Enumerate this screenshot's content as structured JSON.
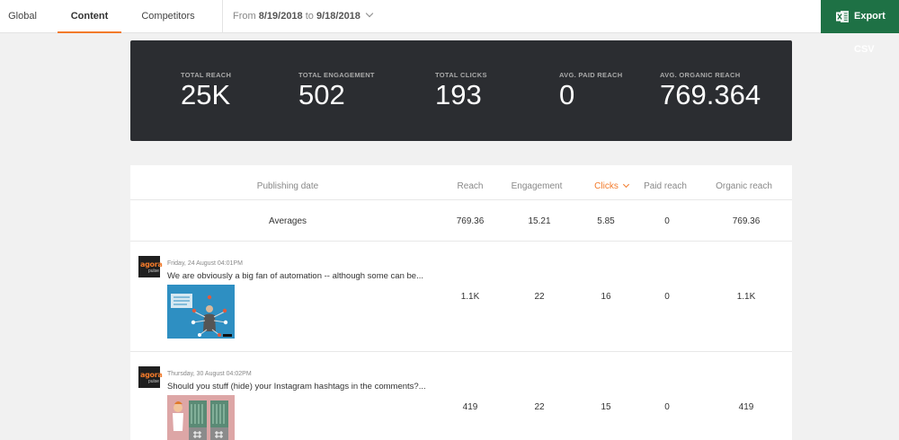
{
  "tabs": [
    {
      "label": "Global"
    },
    {
      "label": "Content"
    },
    {
      "label": "Competitors"
    }
  ],
  "date_range": {
    "prefix": "From",
    "start": "8/19/2018",
    "connector": "to",
    "end": "9/18/2018"
  },
  "export": {
    "label": "Export CSV",
    "icon": "excel-icon",
    "color": "#1e7145"
  },
  "stats": [
    {
      "label": "TOTAL REACH",
      "value": "25K"
    },
    {
      "label": "TOTAL ENGAGEMENT",
      "value": "502"
    },
    {
      "label": "TOTAL CLICKS",
      "value": "193"
    },
    {
      "label": "AVG. PAID REACH",
      "value": "0"
    },
    {
      "label": "AVG. ORGANIC REACH",
      "value": "769.364"
    }
  ],
  "table": {
    "headers": {
      "date": "Publishing date",
      "reach": "Reach",
      "engagement": "Engagement",
      "clicks": "Clicks",
      "paid": "Paid reach",
      "organic": "Organic reach"
    },
    "averages": {
      "label": "Averages",
      "reach": "769.36",
      "engagement": "15.21",
      "clicks": "5.85",
      "paid": "0",
      "organic": "769.36"
    },
    "rows": [
      {
        "avatar_main": "agora",
        "avatar_sub": "pulse",
        "date": "Friday, 24 August 04:01PM",
        "text": "We are obviously a big fan of automation -- although some can be...",
        "reach": "1.1K",
        "engagement": "22",
        "clicks": "16",
        "paid": "0",
        "organic": "1.1K"
      },
      {
        "avatar_main": "agora",
        "avatar_sub": "pulse",
        "date": "Thursday, 30 August 04:02PM",
        "text": "Should you stuff (hide) your Instagram hashtags in the comments?...",
        "reach": "419",
        "engagement": "22",
        "clicks": "15",
        "paid": "0",
        "organic": "419"
      }
    ]
  },
  "colors": {
    "accent": "#f27a2a",
    "panel": "#2b2d31"
  }
}
